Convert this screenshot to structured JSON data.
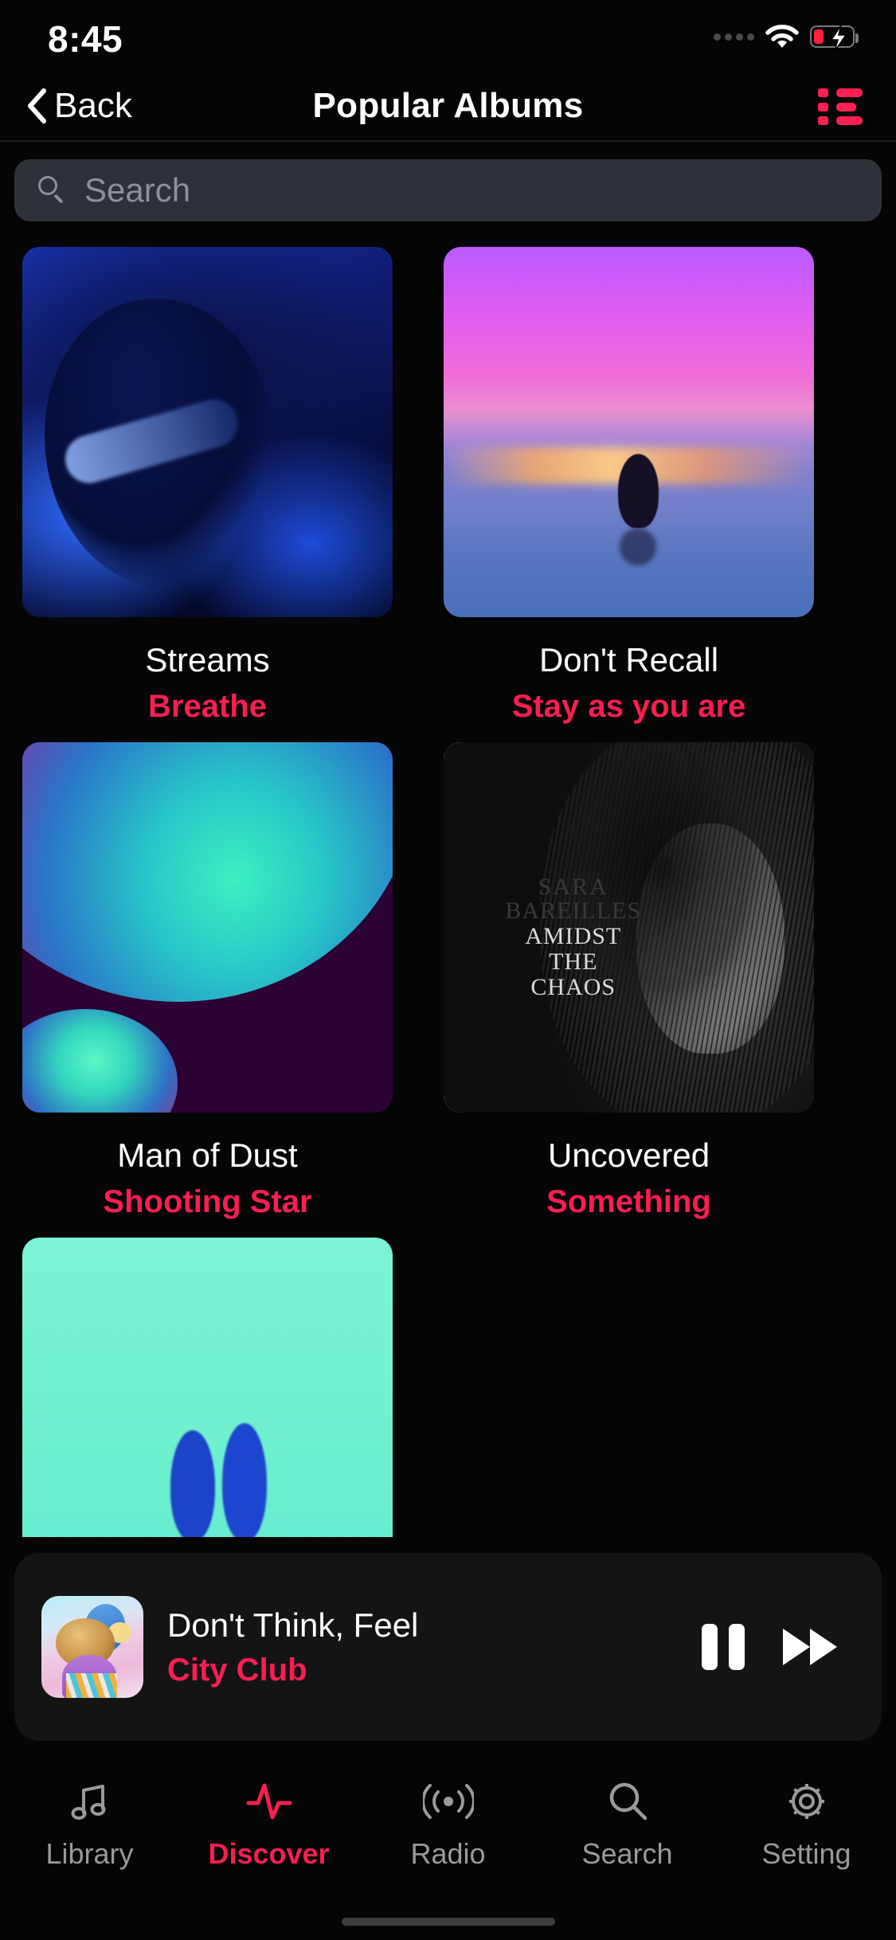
{
  "status_bar": {
    "time": "8:45",
    "signal_icon": "signal-dots-icon",
    "wifi_icon": "wifi-icon",
    "battery_icon": "battery-charging-icon",
    "battery_color": "#ff2040"
  },
  "header": {
    "back_label": "Back",
    "back_icon": "chevron-left-icon",
    "title": "Popular Albums",
    "list_view_icon": "list-view-icon",
    "accent_color": "#fa2152"
  },
  "search": {
    "placeholder": "Search",
    "icon": "search-icon",
    "field_color": "#2e3238",
    "placeholder_color": "#8d9197"
  },
  "albums": [
    {
      "title": "Streams",
      "artist": "Breathe",
      "art": "portrait-blue-sunglasses"
    },
    {
      "title": "Don't Recall",
      "artist": "Stay as you are",
      "art": "pink-sunset-swimmer"
    },
    {
      "title": "Man of Dust",
      "artist": "Shooting Star",
      "art": "teal-magenta-gradient-blobs"
    },
    {
      "title": "Uncovered",
      "artist": "Something",
      "art": "bw-portrait-sara-bareilles"
    },
    {
      "title": "",
      "artist": "",
      "art": "mint-green-cover"
    }
  ],
  "album_art_caption": {
    "artist_line1": "SARA",
    "artist_line2": "BAREILLES",
    "title_line1": "AMIDST",
    "title_line2": "THE",
    "title_line3": "CHAOS"
  },
  "mini_player": {
    "track_title": "Don't Think, Feel",
    "track_artist": "City Club",
    "artwork": "ice-cream-cone-artwork",
    "pause_icon": "pause-icon",
    "next_icon": "fast-forward-icon",
    "artist_color": "#fa1e52"
  },
  "tab_bar": {
    "active": "Discover",
    "items": [
      {
        "label": "Library",
        "icon": "music-note-icon"
      },
      {
        "label": "Discover",
        "icon": "activity-pulse-icon"
      },
      {
        "label": "Radio",
        "icon": "radio-waves-icon"
      },
      {
        "label": "Search",
        "icon": "search-icon"
      },
      {
        "label": "Setting",
        "icon": "gear-icon"
      }
    ]
  }
}
